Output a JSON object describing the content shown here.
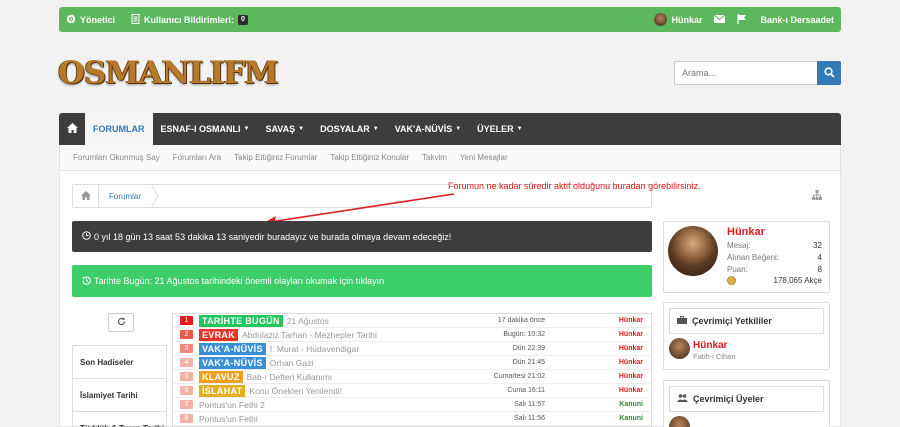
{
  "topbar": {
    "admin_label": "Yönetici",
    "notifications_label": "Kullanıcı Bildirimleri:",
    "notifications_count": "0",
    "username": "Hünkar",
    "bank_label": "Bank-ı Dersaadet"
  },
  "logo": {
    "text": "OSMANLIFM"
  },
  "search": {
    "placeholder": "Arama..."
  },
  "nav": {
    "items": [
      "FORUMLAR",
      "ESNAF-I OSMANLI",
      "SAVAŞ",
      "DOSYALAR",
      "VAK'A-NÜVİS",
      "ÜYELER"
    ]
  },
  "subnav": {
    "items": [
      "Forumları Okunmuş Say",
      "Forumları Ara",
      "Takip Ettiğiniz Forumlar",
      "Takip Ettiğiniz Konular",
      "Takvim",
      "Yeni Mesajlar"
    ]
  },
  "breadcrumb": {
    "label": "Forumlar"
  },
  "annotation": "Forumun ne kadar süredir aktif olduğunu buradan görebilirsiniz.",
  "timebar": "0 yıl 18 gün 13 saat 53 dakika 13 saniyedir buradayız ve burada olmaya devam edeceğiz!",
  "greenbar": "Tarihte Bugün: 21 Ağustos tarihindeki önemli olayları okumak için tıklayın",
  "tabs": [
    "Son Hadiseler",
    "İslamiyet Tarihi",
    "Türklük & Turan Tarihi"
  ],
  "recent": [
    {
      "n": "1",
      "tag": "TARİHTE BUGÜN",
      "tag_color": "#22c55e",
      "num_color": "#e01b1b",
      "title": "21 Ağustos",
      "time": "17 dakika önce",
      "user": "Hünkar",
      "user_color": "#e01b1b"
    },
    {
      "n": "2",
      "tag": "EVRAK",
      "tag_color": "#e5352b",
      "num_color": "#e55b4a",
      "title": "Abdulaziz Tarhan - Mezhepler Tarihi",
      "time": "Bugün: 10:32",
      "user": "Hünkar",
      "user_color": "#e01b1b"
    },
    {
      "n": "3",
      "tag": "VAK'A-NÜVİS",
      "tag_color": "#3a8fd6",
      "num_color": "#ef8a7a",
      "title": "I. Murat - Hüdavendigar",
      "time": "Dün 22:39",
      "user": "Hünkar",
      "user_color": "#e01b1b"
    },
    {
      "n": "4",
      "tag": "VAK'A-NÜVİS",
      "tag_color": "#3a8fd6",
      "num_color": "#f2b2a8",
      "title": "Orhan Gazi",
      "time": "Dün 21:45",
      "user": "Hünkar",
      "user_color": "#e01b1b"
    },
    {
      "n": "5",
      "tag": "KLAVUZ",
      "tag_color": "#f0a020",
      "num_color": "#f2b2a8",
      "title": "Bab-ı Defteri Kullanımı",
      "time": "Cumartesi 21:02",
      "user": "Hünkar",
      "user_color": "#e01b1b"
    },
    {
      "n": "6",
      "tag": "İSLAHAT",
      "tag_color": "#e0b020",
      "num_color": "#f2b2a8",
      "title": "Konu Önekleri Yenilendi!",
      "time": "Cuma 16:11",
      "user": "Hünkar",
      "user_color": "#e01b1b"
    },
    {
      "n": "7",
      "tag": "",
      "tag_color": "",
      "num_color": "#f2b2a8",
      "title": "Pontus'un Fethi 2",
      "time": "Salı 11:57",
      "user": "Kanuni",
      "user_color": "#2e8b3a"
    },
    {
      "n": "8",
      "tag": "",
      "tag_color": "",
      "num_color": "#f2b2a8",
      "title": "Pontus'un Fethi",
      "time": "Salı 11:56",
      "user": "Kanuni",
      "user_color": "#2e8b3a"
    }
  ],
  "profile": {
    "name": "Hünkar",
    "stats": [
      {
        "label": "Mesaj:",
        "value": "32"
      },
      {
        "label": "Alınan Beğeni:",
        "value": "4"
      },
      {
        "label": "Puan:",
        "value": "8"
      }
    ],
    "akce": "178,065 Akçe"
  },
  "online_staff": {
    "title": "Çevrimiçi Yetkililer",
    "user": "Hünkar",
    "user_title": "Fatih-i Cihan"
  },
  "online_members": {
    "title": "Çevrimiçi Üyeler"
  }
}
